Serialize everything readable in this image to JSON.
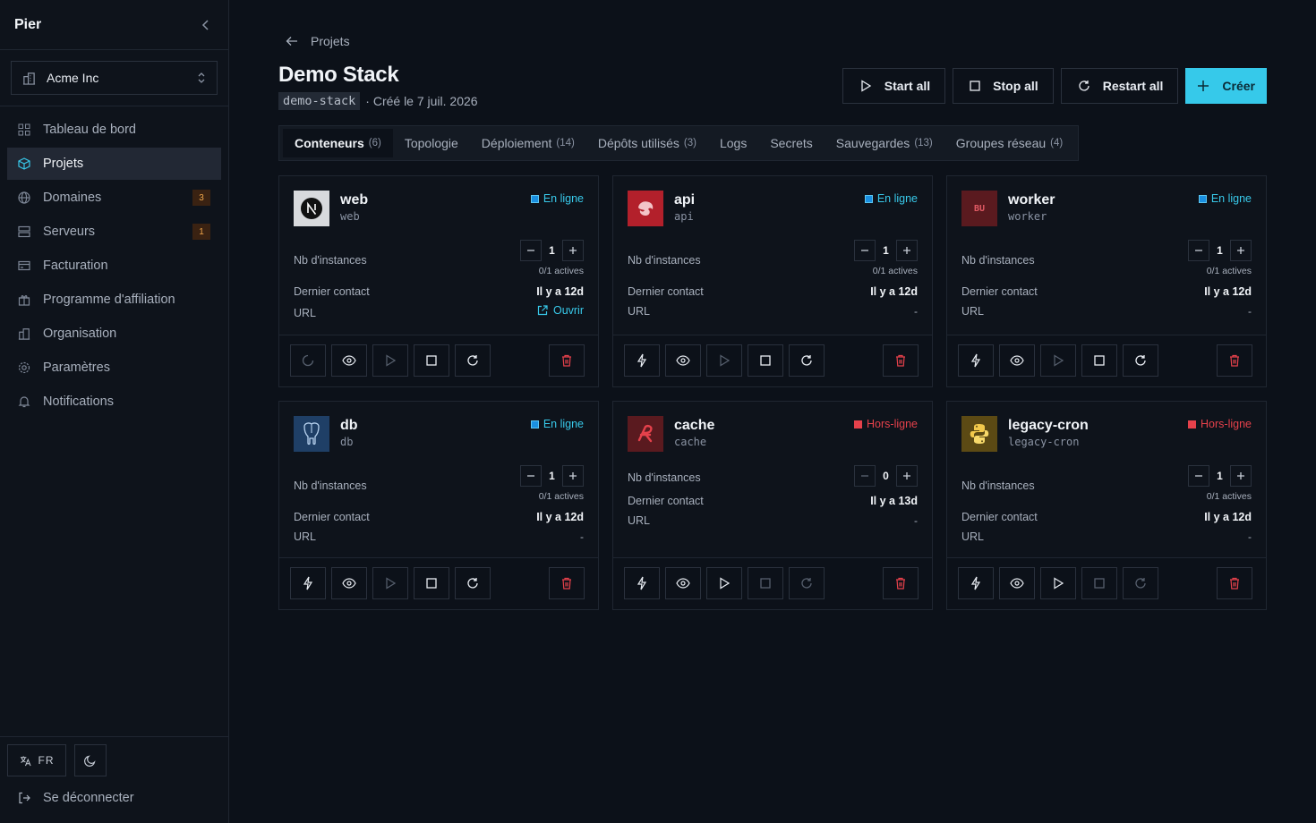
{
  "sidebar": {
    "brand": "Pier",
    "org": "Acme Inc",
    "items": [
      {
        "label": "Tableau de bord",
        "icon": "dashboard-icon"
      },
      {
        "label": "Projets",
        "icon": "box-icon"
      },
      {
        "label": "Domaines",
        "icon": "globe-icon",
        "badge": "3"
      },
      {
        "label": "Serveurs",
        "icon": "server-icon",
        "badge": "1"
      },
      {
        "label": "Facturation",
        "icon": "credit-card-icon"
      },
      {
        "label": "Programme d'affiliation",
        "icon": "gift-icon"
      },
      {
        "label": "Organisation",
        "icon": "building-icon"
      },
      {
        "label": "Paramètres",
        "icon": "gear-icon"
      },
      {
        "label": "Notifications",
        "icon": "bell-icon"
      }
    ],
    "lang": "FR",
    "logout": "Se déconnecter"
  },
  "breadcrumb": "Projets",
  "project": {
    "title": "Demo Stack",
    "slug": "demo-stack",
    "created": "· Créé le 7 juil. 2026"
  },
  "actions": {
    "start_all": "Start all",
    "stop_all": "Stop all",
    "restart_all": "Restart all",
    "create": "Créer"
  },
  "tabs": [
    {
      "label": "Conteneurs",
      "count": "(6)"
    },
    {
      "label": "Topologie",
      "count": ""
    },
    {
      "label": "Déploiement",
      "count": "(14)"
    },
    {
      "label": "Dépôts utilisés",
      "count": "(3)"
    },
    {
      "label": "Logs",
      "count": ""
    },
    {
      "label": "Secrets",
      "count": ""
    },
    {
      "label": "Sauvegardes",
      "count": "(13)"
    },
    {
      "label": "Groupes réseau",
      "count": "(4)"
    }
  ],
  "labels": {
    "instances": "Nb d'instances",
    "last_contact": "Dernier contact",
    "url": "URL",
    "open": "Ouvrir"
  },
  "containers": [
    {
      "name": "web",
      "image": "web",
      "status": "En ligne",
      "instances": "1",
      "actives": "0/1 actives",
      "last_contact": "Il y a 12d",
      "url": "Ouvrir"
    },
    {
      "name": "api",
      "image": "api",
      "status": "En ligne",
      "instances": "1",
      "actives": "0/1 actives",
      "last_contact": "Il y a 12d",
      "url": "-"
    },
    {
      "name": "worker",
      "image": "worker",
      "status": "En ligne",
      "instances": "1",
      "actives": "0/1 actives",
      "last_contact": "Il y a 12d",
      "url": "-",
      "logo_text": "BU"
    },
    {
      "name": "db",
      "image": "db",
      "status": "En ligne",
      "instances": "1",
      "actives": "0/1 actives",
      "last_contact": "Il y a 12d",
      "url": "-"
    },
    {
      "name": "cache",
      "image": "cache",
      "status": "Hors-ligne",
      "instances": "0",
      "actives": "",
      "last_contact": "Il y a 13d",
      "url": "-"
    },
    {
      "name": "legacy-cron",
      "image": "legacy-cron",
      "status": "Hors-ligne",
      "instances": "1",
      "actives": "0/1 actives",
      "last_contact": "Il y a 12d",
      "url": "-"
    }
  ],
  "colors": {
    "accent": "#36c9ea",
    "online": "#38c9ea",
    "offline": "#e5414b",
    "background": "#0c1119"
  }
}
